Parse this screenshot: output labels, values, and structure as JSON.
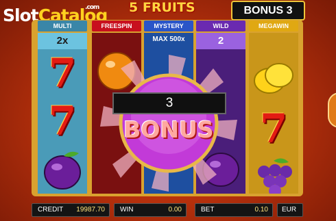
{
  "watermark": {
    "slot": "Slot",
    "catalog": "Catalog",
    "com": ".com"
  },
  "game_title": "5 FRUITS",
  "bonus_counter": "BONUS 3",
  "columns": [
    {
      "header": "MULTI",
      "value": "2x",
      "color": "#3a86a8",
      "reel_bg": "#4a9bb8"
    },
    {
      "header": "FREESPIN",
      "value": "",
      "color": "#c8101e",
      "reel_bg": "#8a1010"
    },
    {
      "header": "MYSTERY",
      "value": "MAX 500x",
      "color": "#2a55c8",
      "reel_bg": "#1e4fa0"
    },
    {
      "header": "WILD",
      "value": "2",
      "color": "#6a2ab0",
      "reel_bg": "#4a1e7a"
    },
    {
      "header": "MEGAWIN",
      "value": "",
      "color": "#e0a812",
      "reel_bg": "#c9961a"
    }
  ],
  "overlay": {
    "count": "3",
    "label": "BONUS"
  },
  "bottom_bar": {
    "credit_label": "CREDIT",
    "credit_value": "19987.70",
    "win_label": "WIN",
    "win_value": "0.00",
    "bet_label": "BET",
    "bet_value": "0.10",
    "currency": "EUR"
  },
  "symbols": [
    "seven",
    "seven",
    "plum",
    "orange",
    "lemon",
    "seven",
    "grapes"
  ],
  "colors": {
    "frame_gold": "#d9a22f",
    "bonus_magenta": "#c23ad8"
  }
}
